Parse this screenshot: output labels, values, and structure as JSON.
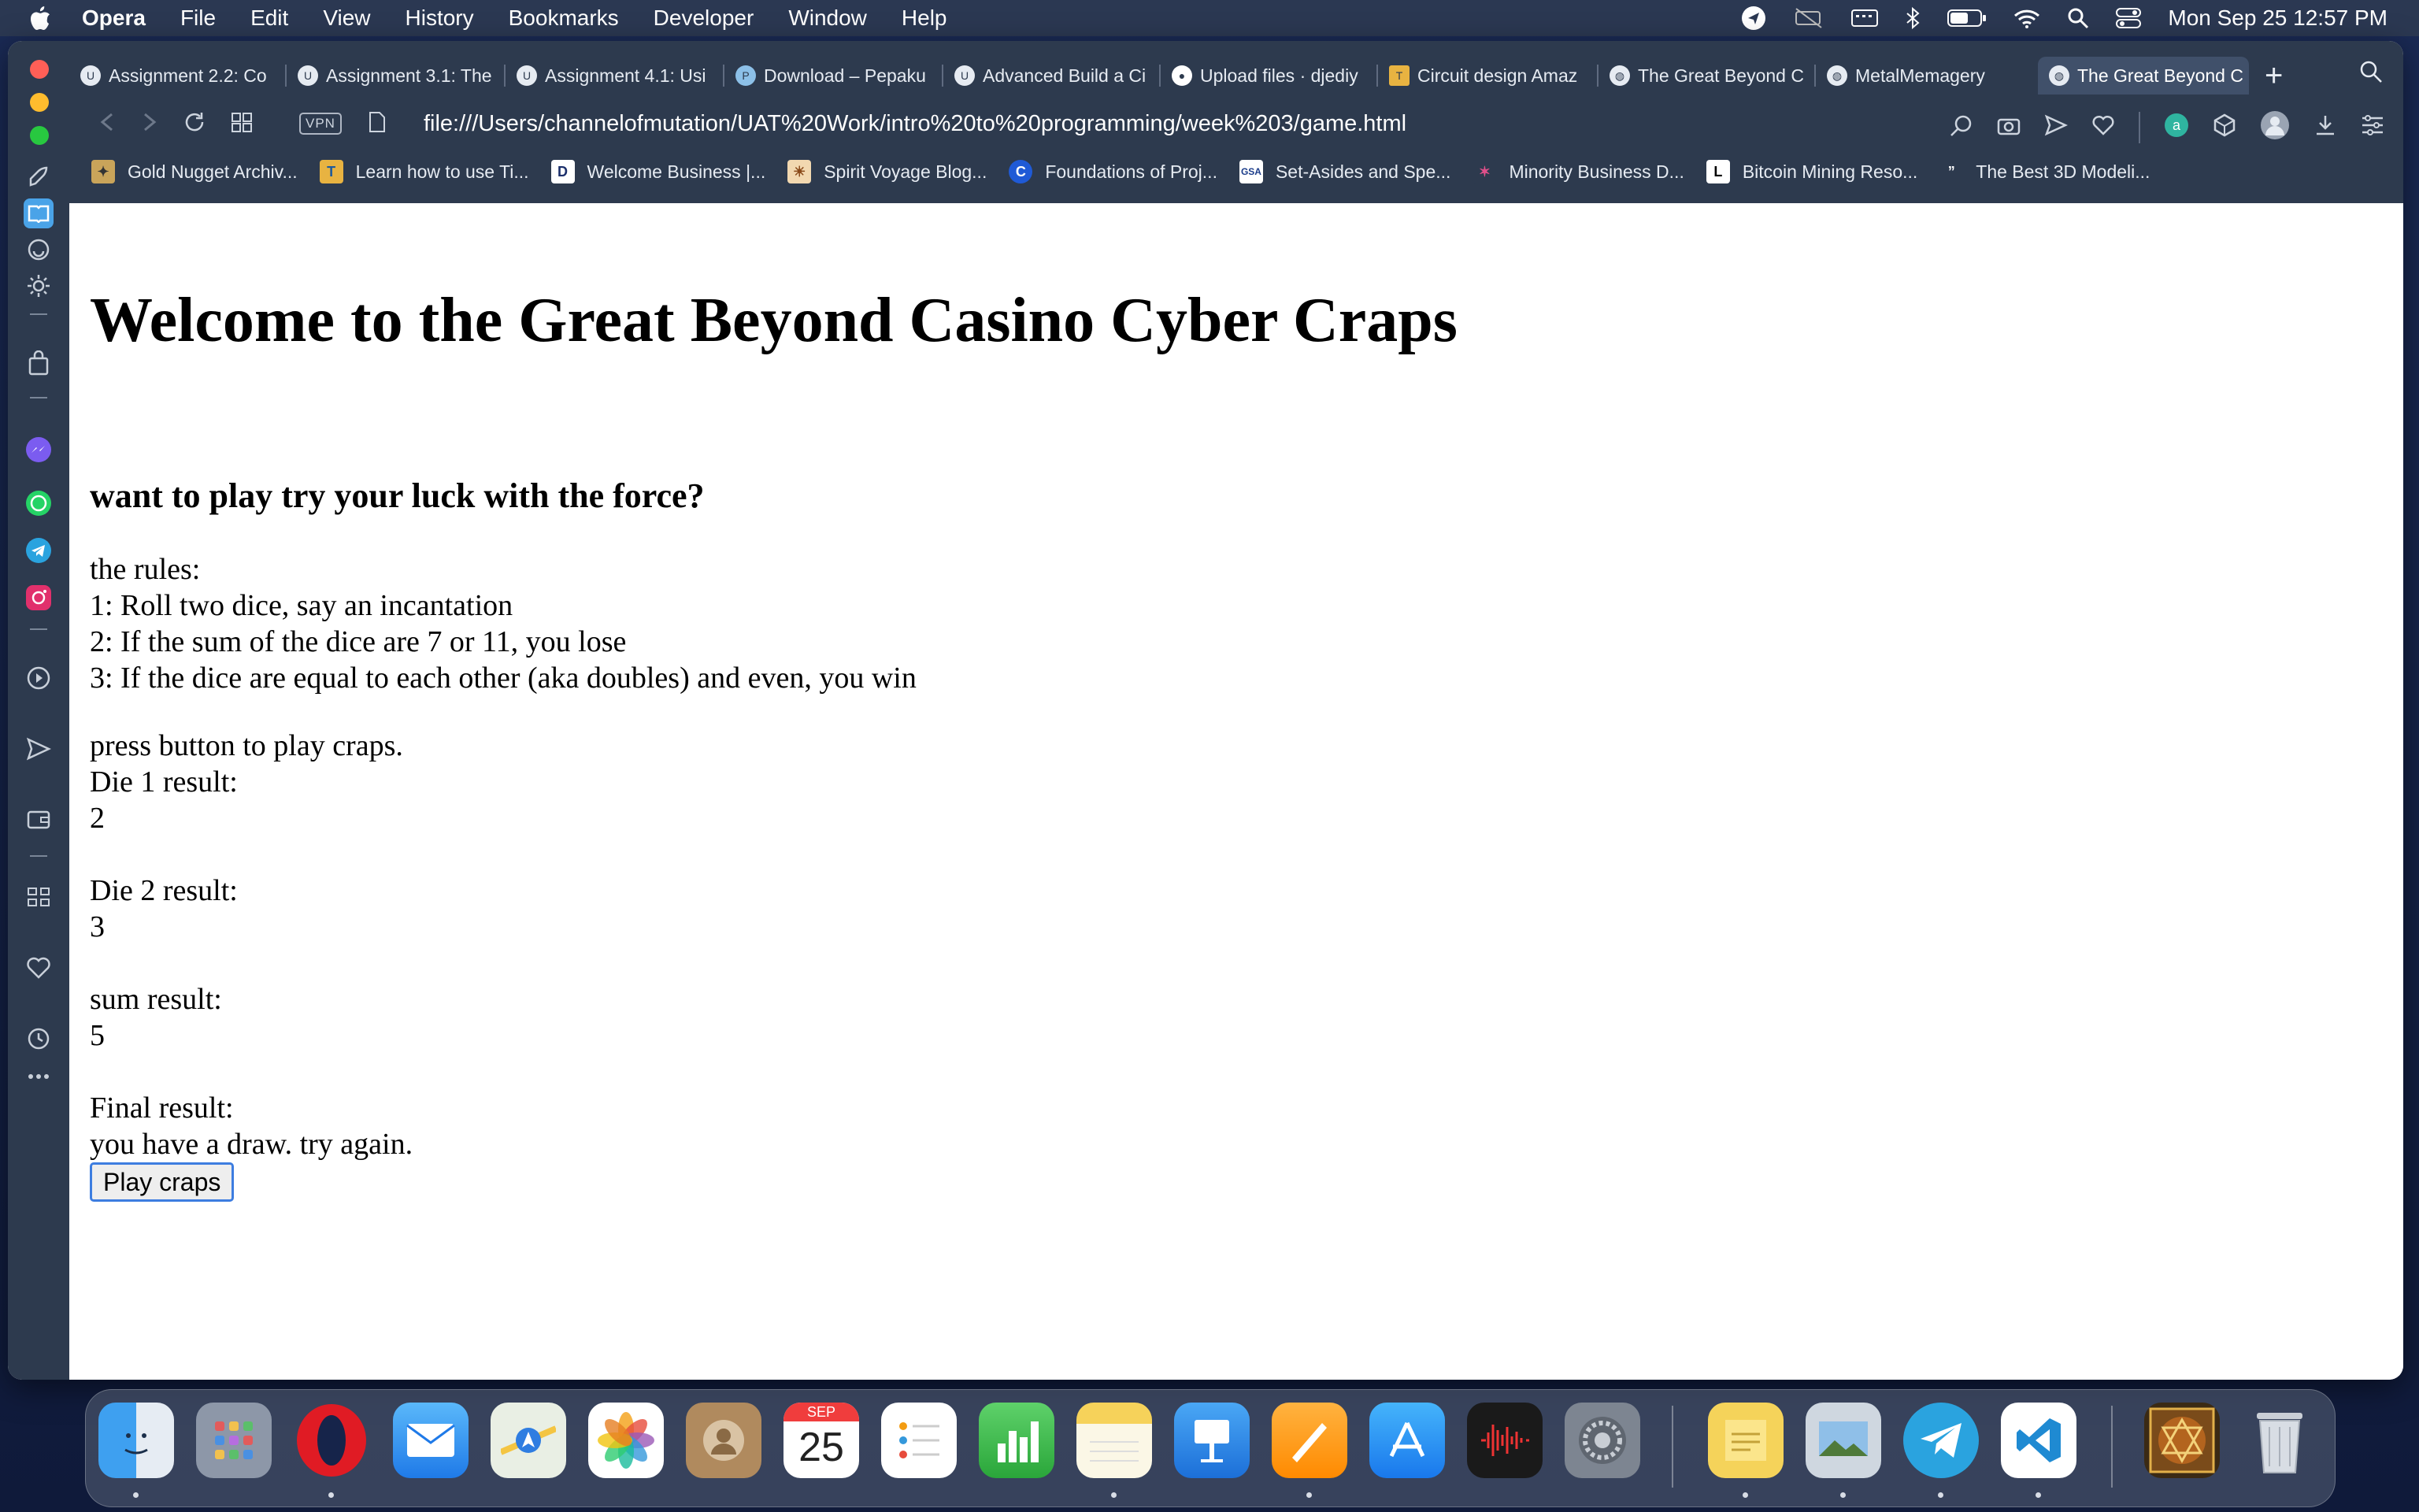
{
  "menubar": {
    "app_name": "Opera",
    "items": [
      "File",
      "Edit",
      "View",
      "History",
      "Bookmarks",
      "Developer",
      "Window",
      "Help"
    ],
    "clock": "Mon Sep 25  12:57 PM"
  },
  "tabs": [
    {
      "label": "Assignment 2.2: Co",
      "icon": "uat-icon"
    },
    {
      "label": "Assignment 3.1: The",
      "icon": "uat-icon"
    },
    {
      "label": "Assignment 4.1: Usi",
      "icon": "uat-icon"
    },
    {
      "label": "Download – Pepaku",
      "icon": "pepakura-icon"
    },
    {
      "label": "Advanced Build a Ci",
      "icon": "uat-icon"
    },
    {
      "label": "Upload files · djediy",
      "icon": "github-icon"
    },
    {
      "label": "Circuit design Amaz",
      "icon": "tinkercad-icon"
    },
    {
      "label": "The Great Beyond C",
      "icon": "globe-icon"
    },
    {
      "label": "MetalMemagery",
      "icon": "globe-icon"
    },
    {
      "label": "The Great Beyond C",
      "icon": "globe-icon",
      "active": true
    }
  ],
  "address": {
    "vpn": "VPN",
    "url": "file:///Users/channelofmutation/UAT%20Work/intro%20to%20programming/week%203/game.html"
  },
  "bookmarks": [
    {
      "label": "Gold Nugget Archiv...",
      "icon": "gold-nugget-icon"
    },
    {
      "label": "Learn how to use Ti...",
      "icon": "tinkercad-icon"
    },
    {
      "label": "Welcome Business |...",
      "icon": "business-icon"
    },
    {
      "label": "Spirit Voyage Blog...",
      "icon": "spirit-voyage-icon"
    },
    {
      "label": "Foundations of Proj...",
      "icon": "coursera-icon"
    },
    {
      "label": "Set-Asides and Spe...",
      "icon": "gsa-icon"
    },
    {
      "label": "Minority Business D...",
      "icon": "mbda-icon"
    },
    {
      "label": "Bitcoin Mining Reso...",
      "icon": "l-icon"
    },
    {
      "label": "The Best 3D Modeli...",
      "icon": "quote-icon"
    }
  ],
  "page": {
    "title": "Welcome to the Great Beyond Casino Cyber Craps",
    "subtitle": "want to play try your luck with the force?",
    "rules_heading": "the rules:",
    "rules": [
      "1: Roll two dice, say an incantation",
      "2: If the sum of the dice are 7 or 11, you lose",
      "3: If the dice are equal to each other (aka doubles) and even, you win"
    ],
    "prompt": "press button to play craps.",
    "die1_label": "Die 1 result:",
    "die1_value": "2",
    "die2_label": "Die 2 result:",
    "die2_value": "3",
    "sum_label": "sum result:",
    "sum_value": "5",
    "final_label": "Final result:",
    "final_value": "you have a draw. try again.",
    "button_label": "Play craps"
  },
  "dock": {
    "calendar_month": "SEP",
    "calendar_day": "25",
    "apps": [
      "finder",
      "launchpad",
      "opera",
      "mail",
      "maps",
      "photos",
      "contacts",
      "calendar",
      "reminders",
      "numbers",
      "notes",
      "keynote",
      "pages",
      "app-store",
      "voice-memos",
      "system-settings",
      "stickies",
      "preview",
      "telegram",
      "vscode",
      "image",
      "trash"
    ]
  }
}
